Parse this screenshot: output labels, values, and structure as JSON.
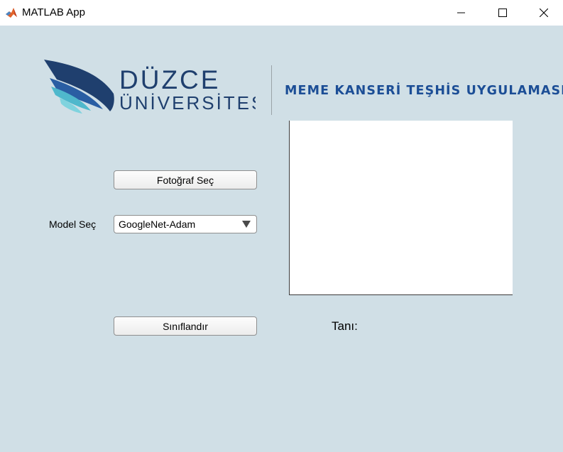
{
  "window": {
    "title": "MATLAB App",
    "controls": [
      "minimize-icon",
      "maximize-icon",
      "close-icon"
    ]
  },
  "header": {
    "logo_line1": "DÜZCE",
    "logo_line2": "ÜNİVERSİTESİ",
    "app_title": "MEME KANSERİ TEŞHİS UYGULAMASI"
  },
  "controls": {
    "photo_button": "Fotoğraf Seç",
    "model_label": "Model Seç",
    "model_selected": "GoogleNet-Adam",
    "classify_button": "Sınıflandır",
    "diagnosis_label": "Tanı:"
  },
  "colors": {
    "background": "#d0dfe6",
    "title_blue": "#1c4e96",
    "logo_dark": "#1f3f6e",
    "logo_cyan": "#4fb8cc"
  }
}
